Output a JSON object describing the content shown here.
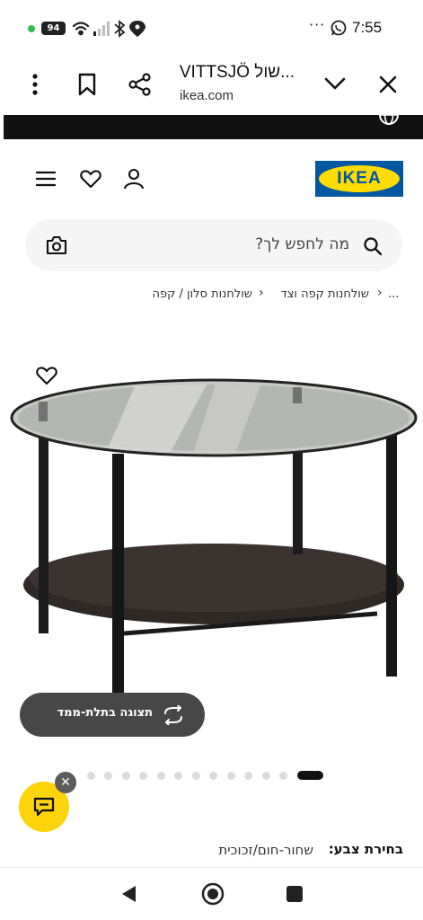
{
  "status_bar": {
    "battery": "94",
    "time": "7:55",
    "more": "···"
  },
  "browser": {
    "page_title": "VITTSJÖ שול...",
    "url": "ikea.com"
  },
  "top_strip": {
    "language": "HE"
  },
  "header": {
    "logo_text": "IKEA",
    "search_placeholder": "מה לחפש לך?"
  },
  "breadcrumb": {
    "ellipsis": "...",
    "items": [
      "שולחנות קפה וצד",
      "שולחנות סלון / קפה"
    ]
  },
  "gallery": {
    "view_3d_label": "תצוגה בתלת-ממד",
    "dot_count": 13,
    "active_dot": 0
  },
  "product": {
    "color_label": "בחירת צבע:",
    "color_value": "שחור-חום/זכוכית"
  },
  "colors": {
    "ikea_blue": "#0058a3",
    "ikea_yellow": "#ffdb00",
    "chat_yellow": "#fdd30a",
    "dark_button": "#474747"
  }
}
